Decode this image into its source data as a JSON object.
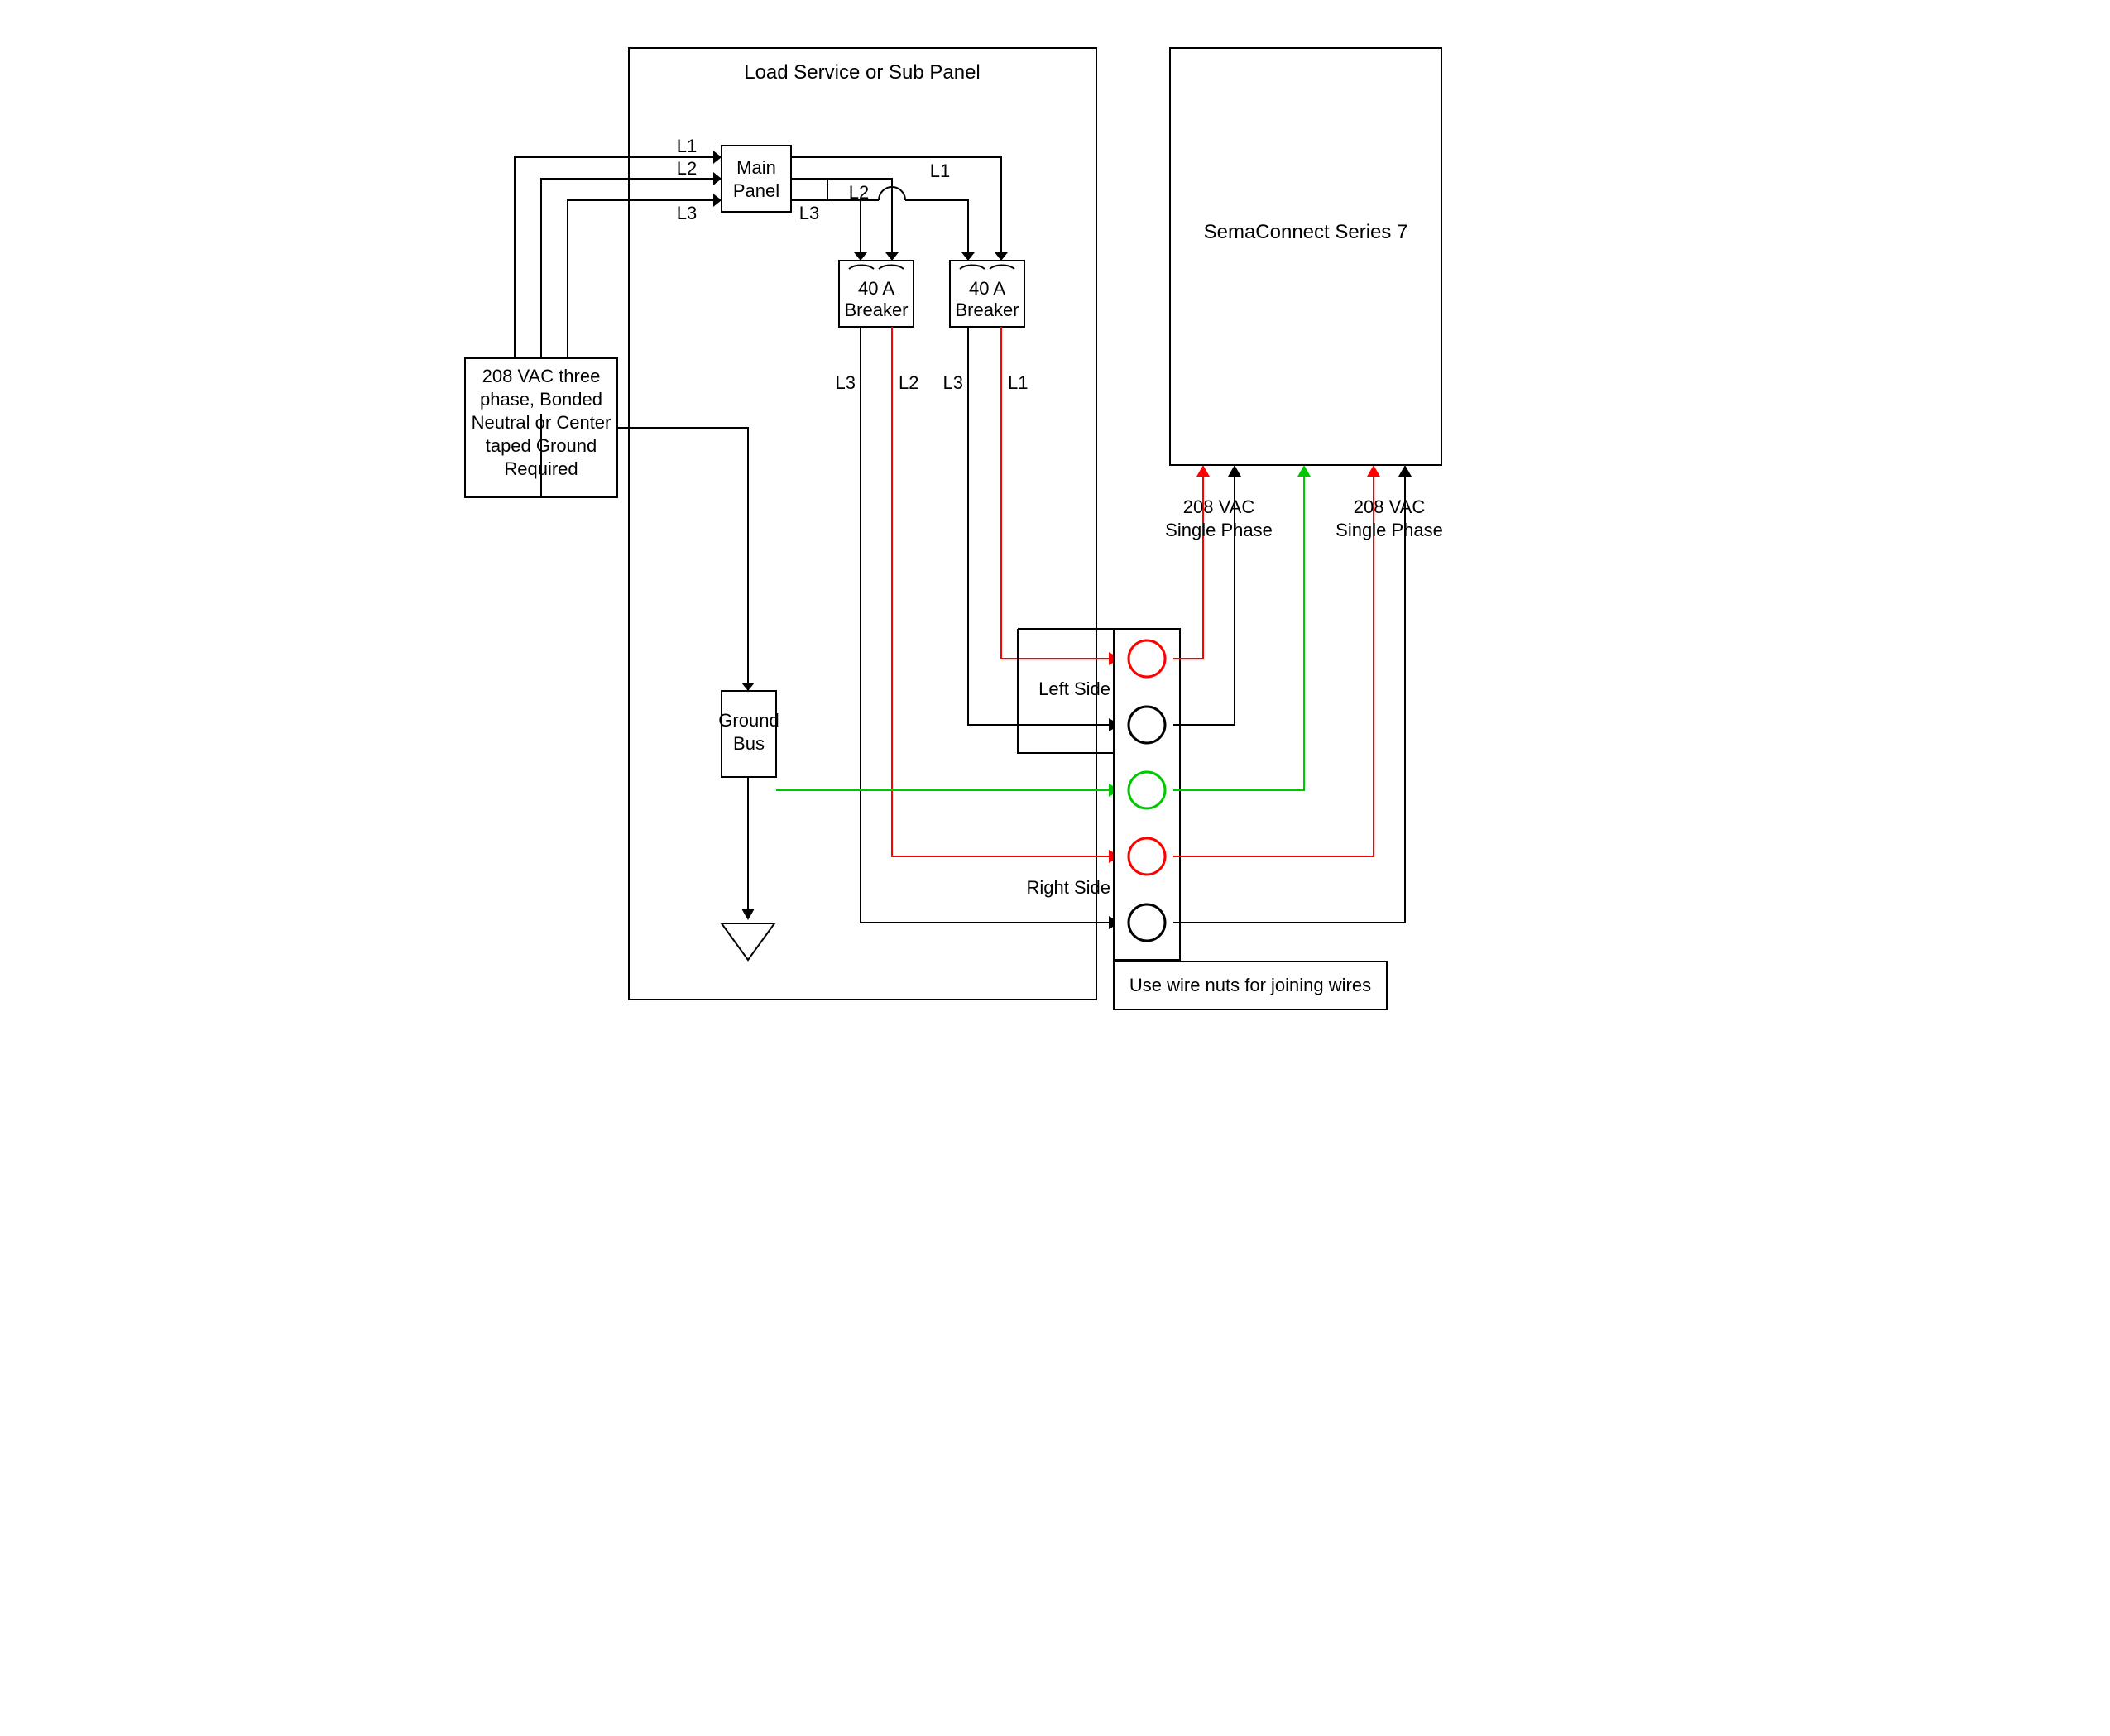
{
  "panel": {
    "title": "Load Service or Sub Panel"
  },
  "source": {
    "line1": "208 VAC three",
    "line2": "phase, Bonded",
    "line3": "Neutral or Center",
    "line4": "taped Ground",
    "line5": "Required"
  },
  "main_panel": {
    "line1": "Main",
    "line2": "Panel"
  },
  "breaker": {
    "line1": "40 A",
    "line2": "Breaker"
  },
  "ground_bus": {
    "line1": "Ground",
    "line2": "Bus"
  },
  "phases": {
    "l1": "L1",
    "l2": "L2",
    "l3": "L3"
  },
  "sides": {
    "left": "Left Side",
    "right": "Right Side"
  },
  "sema": {
    "title": "SemaConnect Series 7"
  },
  "phase_label": {
    "line1": "208 VAC",
    "line2": "Single Phase"
  },
  "note": "Use wire nuts for joining wires"
}
